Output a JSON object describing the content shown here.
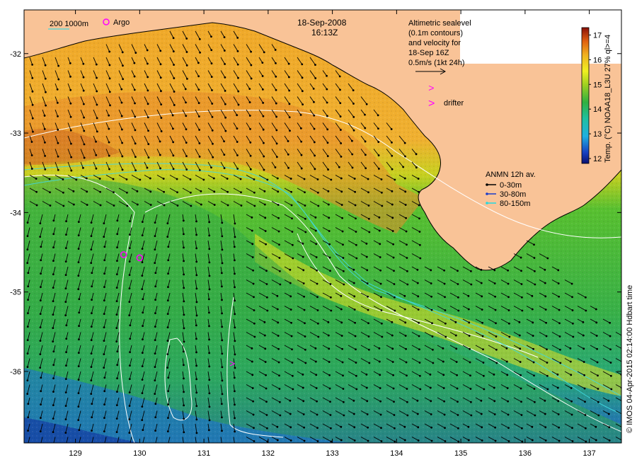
{
  "header": {
    "date": "18-Sep-2008",
    "time": "16:13Z"
  },
  "scale_legend": {
    "contours": "200  1000m",
    "argo_label": "Argo"
  },
  "altimetry_note": {
    "lines": [
      "Altimetric sealevel",
      "(0.1m contours)",
      "and velocity for",
      "18-Sep 16Z",
      "0.5m/s (1kt 24h)"
    ]
  },
  "drifter_legend": {
    "label": "drifter",
    "symbol": ">"
  },
  "anmn_legend": {
    "title": "ANMN 12h av.",
    "items": [
      {
        "label": "0-30m",
        "color": "#000000"
      },
      {
        "label": "30-80m",
        "color": "#1a3cc8"
      },
      {
        "label": "80-150m",
        "color": "#22d8e0"
      }
    ]
  },
  "colorbar": {
    "title": "Temp. (°C) NOAA18_L3U 27% ql>=4",
    "ticks": [
      "12",
      "13",
      "14",
      "15",
      "16",
      "17"
    ],
    "min": 11.8,
    "max": 17.3
  },
  "axes": {
    "x_ticks": [
      "129",
      "130",
      "131",
      "132",
      "133",
      "134",
      "135",
      "136",
      "137"
    ],
    "y_ticks": [
      "-32",
      "-33",
      "-34",
      "-35",
      "-36"
    ],
    "lon_range": [
      128.2,
      137.5
    ],
    "lat_range": [
      -36.9,
      -31.45
    ]
  },
  "credit": "© IMOS 04-Apr-2015 02:14:00 Hdbart time",
  "argo_floats": [
    {
      "lon": 129.6,
      "lat": -31.4
    },
    {
      "lon": 129.75,
      "lat": -34.53
    },
    {
      "lon": 130.0,
      "lat": -34.57
    }
  ],
  "drifters": [
    {
      "lon": 134.55,
      "lat": -32.43
    },
    {
      "lon": 131.45,
      "lat": -35.9
    }
  ],
  "colors": {
    "land": "#f9c397",
    "warm_sst": "#f0a020",
    "cool_sst": "#30a040",
    "cold_sst": "#2070d0"
  }
}
